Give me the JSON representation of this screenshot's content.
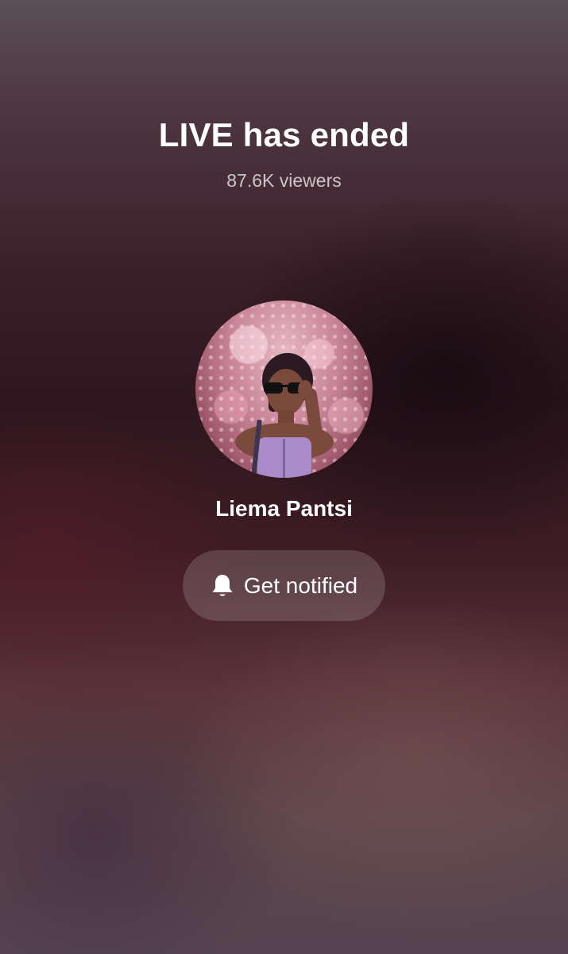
{
  "live": {
    "title": "LIVE has ended",
    "viewers": "87.6K viewers"
  },
  "host": {
    "name": "Liema Pantsi",
    "avatar_icon": "profile-photo"
  },
  "notify_button": {
    "label": "Get notified",
    "icon": "bell-icon"
  },
  "colors": {
    "text": "#ffffff",
    "button_bg": "rgba(255,255,255,0.16)",
    "background_top": "#5b4f57",
    "background_mid": "#2f161e",
    "background_bottom": "#554450"
  }
}
